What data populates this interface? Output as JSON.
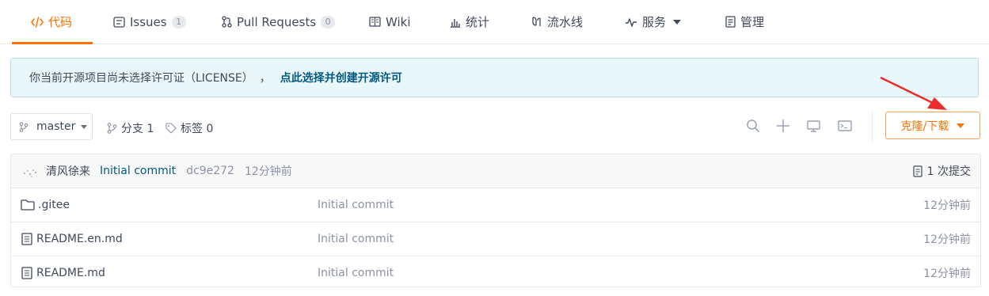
{
  "tabs": [
    {
      "label": "代码",
      "icon": "code-icon",
      "active": true
    },
    {
      "label": "Issues",
      "icon": "issues-icon",
      "badge": "1"
    },
    {
      "label": "Pull Requests",
      "icon": "pull-request-icon",
      "badge": "0"
    },
    {
      "label": "Wiki",
      "icon": "wiki-icon"
    },
    {
      "label": "统计",
      "icon": "stats-icon"
    },
    {
      "label": "流水线",
      "icon": "pipeline-icon"
    },
    {
      "label": "服务",
      "icon": "pulse-icon",
      "dropdown": true
    },
    {
      "label": "管理",
      "icon": "manage-icon"
    }
  ],
  "notice": {
    "text": "你当前开源项目尚未选择许可证（LICENSE）",
    "separator": "，",
    "link": "点此选择并创建开源许可"
  },
  "toolbar": {
    "branch": "master",
    "branches_label": "分支 1",
    "tags_label": "标签 0",
    "clone_label": "克隆/下载"
  },
  "last_commit": {
    "author": "清风徐来",
    "message": "Initial commit",
    "sha": "dc9e272",
    "time": "12分钟前",
    "count_label": "1 次提交"
  },
  "files": [
    {
      "name": ".gitee",
      "type": "folder",
      "commit": "Initial commit",
      "time": "12分钟前"
    },
    {
      "name": "README.en.md",
      "type": "file",
      "commit": "Initial commit",
      "time": "12分钟前"
    },
    {
      "name": "README.md",
      "type": "file",
      "commit": "Initial commit",
      "time": "12分钟前"
    }
  ],
  "colors": {
    "accent": "#fe7300",
    "link": "#005980",
    "muted": "#8c92a4",
    "notice_bg": "#eaf7fa",
    "annotation_arrow": "#ee2b2b"
  }
}
